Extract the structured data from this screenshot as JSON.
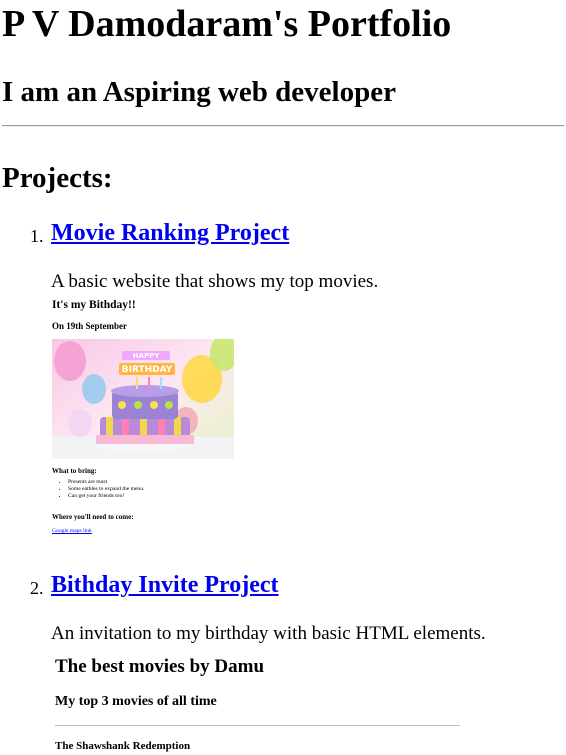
{
  "header": {
    "title": "P V Damodaram's Portfolio",
    "subtitle": "I am an Aspiring web developer"
  },
  "projects": {
    "heading": "Projects:",
    "items": [
      {
        "number": "1.",
        "title": "Movie Ranking Project",
        "description": "A basic website that shows my top movies."
      },
      {
        "number": "2.",
        "title": "Bithday Invite Project",
        "description": "An invitation to my birthday with basic HTML elements."
      }
    ]
  },
  "birthday_preview": {
    "heading": "It's my Bithday!!",
    "date": "On 19th September",
    "image_text": "HAPPY BIRTHDAY",
    "bring_heading": "What to bring:",
    "bring_items": [
      "Presents are must",
      "Some eatbles to expand the menu.",
      "Can get your friends too!"
    ],
    "where_heading": "Where you'll need to come:",
    "map_link": "Google maps link"
  },
  "movies_preview": {
    "heading": "The best movies by Damu",
    "subheading": "My top 3 movies of all time",
    "first_movie": "The Shawshank Redemption"
  }
}
